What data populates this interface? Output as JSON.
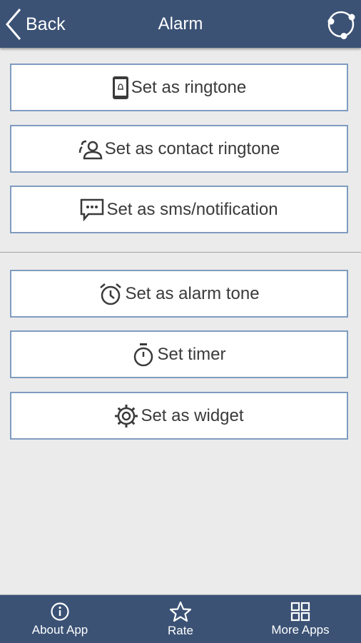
{
  "header": {
    "back_label": "Back",
    "title": "Alarm",
    "sync_icon": "sync-icon"
  },
  "actions_group1": [
    {
      "label": "Set as ringtone",
      "icon": "phone-bell-icon"
    },
    {
      "label": "Set as contact ringtone",
      "icon": "contact-icon"
    },
    {
      "label": "Set as sms/notification",
      "icon": "message-icon"
    }
  ],
  "actions_group2": [
    {
      "label": "Set as alarm tone",
      "icon": "alarm-clock-icon"
    },
    {
      "label": "Set timer",
      "icon": "stopwatch-icon"
    },
    {
      "label": "Set as widget",
      "icon": "widget-gear-icon"
    }
  ],
  "bottom_nav": [
    {
      "label": "About App",
      "icon": "info-icon"
    },
    {
      "label": "Rate",
      "icon": "star-icon"
    },
    {
      "label": "More Apps",
      "icon": "grid-icon"
    }
  ],
  "colors": {
    "bar": "#3b5275",
    "button_border": "#7f9cc0",
    "background": "#ebebeb"
  }
}
